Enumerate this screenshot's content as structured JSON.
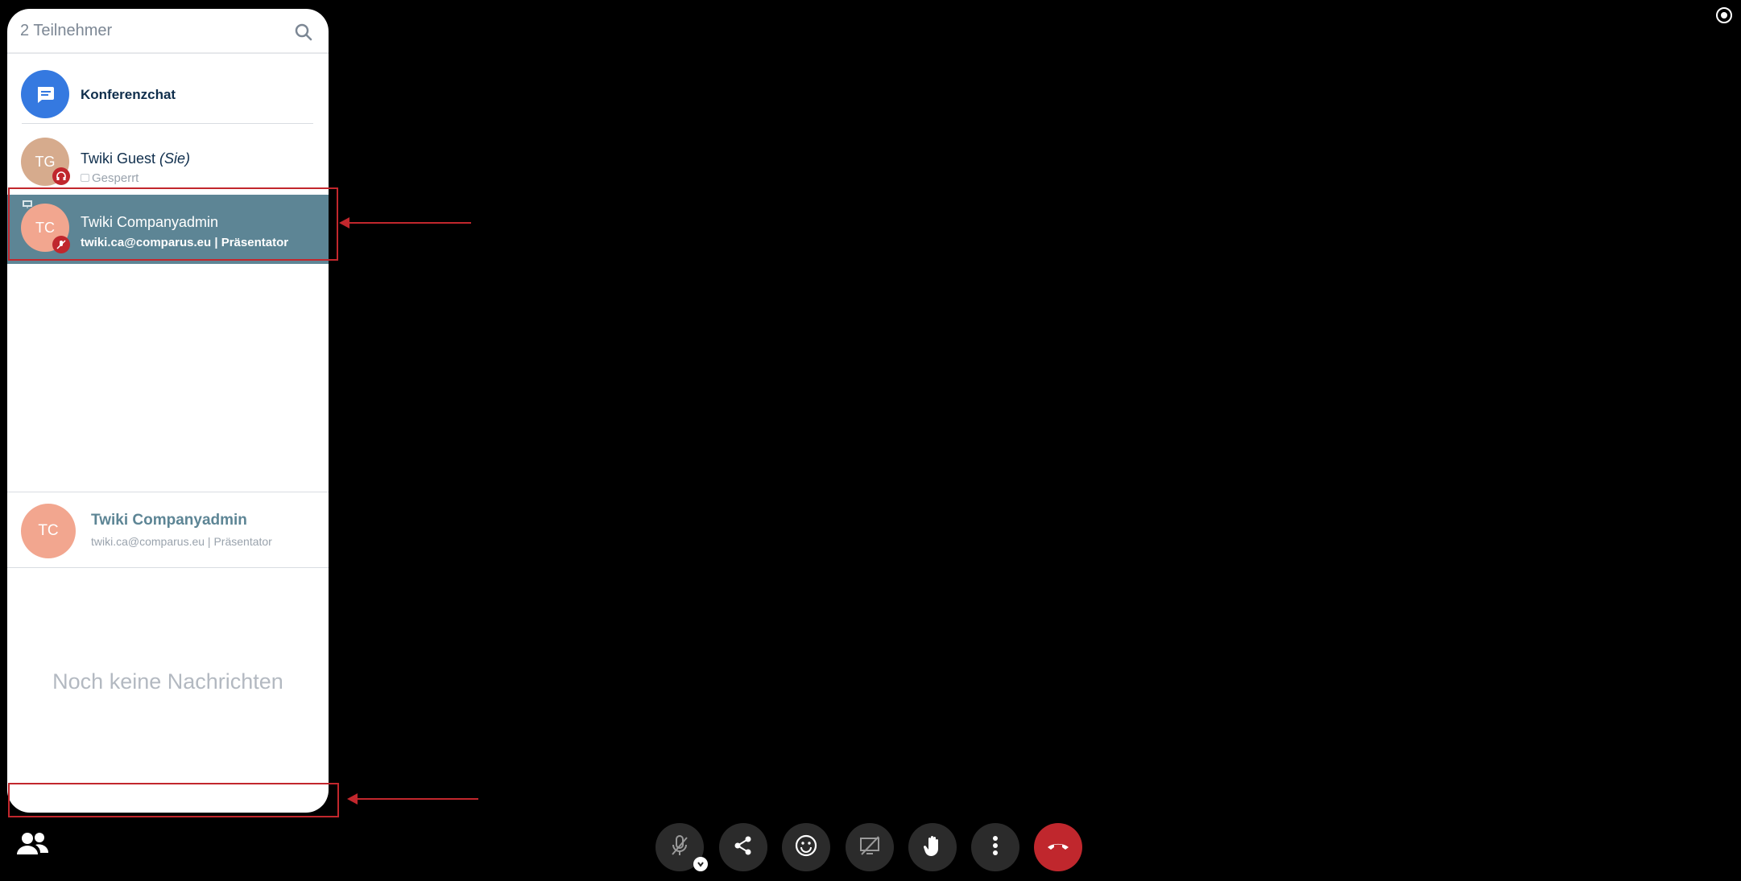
{
  "participants_panel": {
    "title": "2 Teilnehmer",
    "chat_item_label": "Konferenzchat",
    "participants": [
      {
        "initials": "TG",
        "name": "Twiki Guest",
        "self_tag": "(Sie)",
        "status": "Gesperrt",
        "avatar_color": "#d6ab8d"
      },
      {
        "initials": "TC",
        "name": "Twiki Companyadmin",
        "subtitle": "twiki.ca@comparus.eu | Präsentator",
        "avatar_color": "#f2a68f",
        "highlight_color": "#5d8595"
      }
    ]
  },
  "chat_panel": {
    "recipient_initials": "TC",
    "recipient_name": "Twiki Companyadmin",
    "recipient_subtitle": "twiki.ca@comparus.eu | Präsentator",
    "empty_message": "Noch keine Nachrichten"
  },
  "toolbar": {
    "buttons": [
      "mic-muted-icon",
      "share-icon",
      "emoji-icon",
      "screen-share-off-icon",
      "raise-hand-icon",
      "more-vertical-icon",
      "hangup-icon"
    ],
    "hangup_color": "#c0272d"
  },
  "colors": {
    "annotation": "#c2272d"
  }
}
